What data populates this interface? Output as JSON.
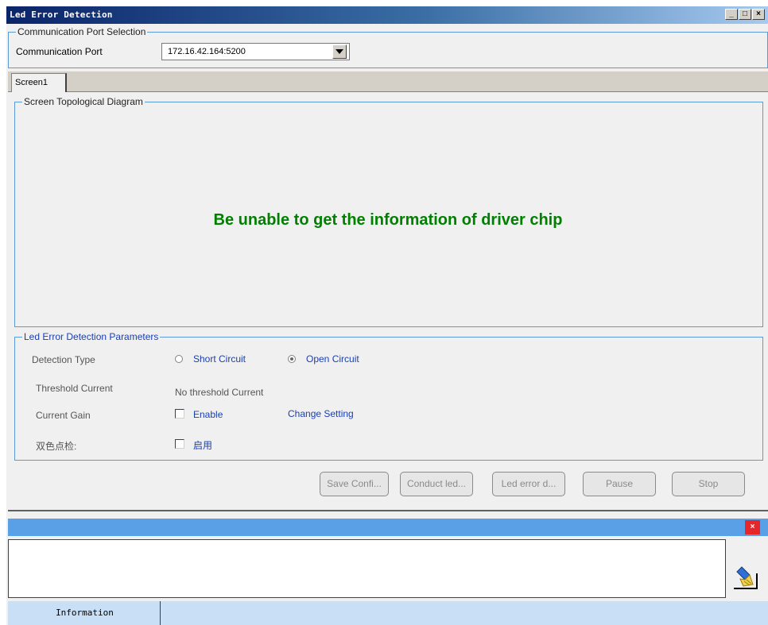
{
  "window": {
    "title": "Led Error Detection"
  },
  "port_section": {
    "legend": "Communication Port Selection",
    "port_label": "Communication Port",
    "port_value": "172.16.42.164:5200"
  },
  "tabs": [
    {
      "label": "Screen1",
      "selected": true
    }
  ],
  "topology": {
    "legend": "Screen Topological Diagram",
    "message": "Be unable to get the information of driver chip",
    "message_color": "#008000"
  },
  "params": {
    "legend": "Led Error Detection Parameters",
    "detection_type_label": "Detection Type",
    "short_circuit_label": "Short Circuit",
    "short_circuit_selected": false,
    "open_circuit_label": "Open Circuit",
    "open_circuit_selected": true,
    "threshold_label": "Threshold Current",
    "threshold_value": "No threshold Current",
    "gain_label": "Current Gain",
    "gain_enable_label": "Enable",
    "gain_enable_checked": false,
    "change_setting_label": "Change Setting",
    "dual_color_label": "双色点检:",
    "dual_color_enable_label": "启用",
    "dual_color_checked": false
  },
  "actions": {
    "save_label": "Save Confi...",
    "conduct_label": "Conduct led...",
    "led_error_label": "Led error d...",
    "pause_label": "Pause",
    "stop_label": "Stop"
  },
  "info_panel": {
    "close_label": "×",
    "tab_label": "Information",
    "bar_color": "#5aa0e6"
  }
}
